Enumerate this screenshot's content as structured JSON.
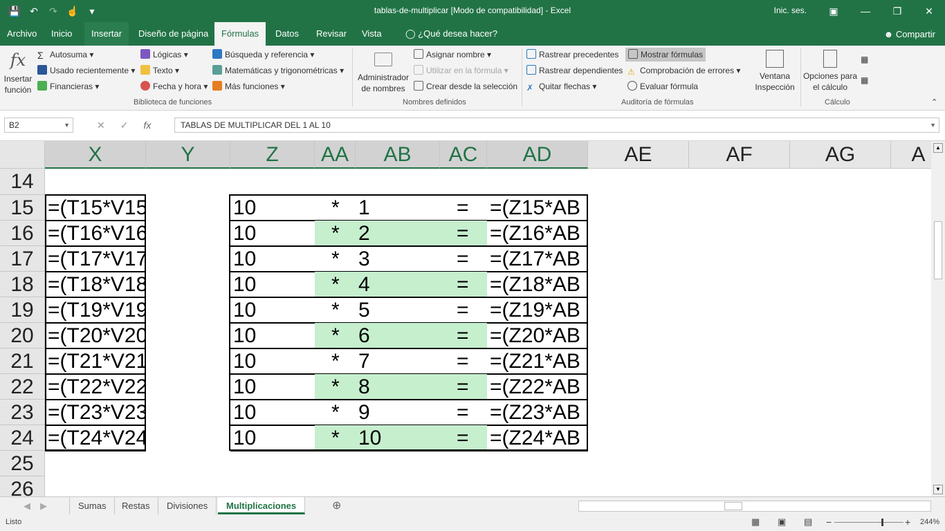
{
  "window": {
    "title": "tablas-de-multiplicar  [Modo de compatibilidad]  -  Excel",
    "signin": "Inic. ses.",
    "qat": [
      "save-icon",
      "undo-icon",
      "redo-icon",
      "touch-icon",
      "customize-icon"
    ]
  },
  "tabs": [
    "Archivo",
    "Inicio",
    "Insertar",
    "Diseño de página",
    "Fórmulas",
    "Datos",
    "Revisar",
    "Vista",
    "¿Qué desea hacer?"
  ],
  "share": "Compartir",
  "ribbon": {
    "insert_fn": "Insertar función",
    "lib": [
      "Autosuma",
      "Usado recientemente",
      "Financieras",
      "Lógicas",
      "Texto",
      "Fecha y hora",
      "Búsqueda y referencia",
      "Matemáticas y trigonométricas",
      "Más funciones"
    ],
    "lib_group": "Biblioteca de funciones",
    "names_admin": "Administrador de nombres",
    "names": [
      "Asignar nombre",
      "Utilizar en la fórmula",
      "Crear desde la selección"
    ],
    "names_group": "Nombres definidos",
    "audit": [
      "Rastrear precedentes",
      "Rastrear dependientes",
      "Quitar flechas",
      "Mostrar fórmulas",
      "Comprobación de errores",
      "Evaluar fórmula"
    ],
    "watch": "Ventana Inspección",
    "audit_group": "Auditoría de fórmulas",
    "calc_opts": "Opciones para el cálculo",
    "calc_group": "Cálculo"
  },
  "formula_bar": {
    "name_box": "B2",
    "formula": "TABLAS DE MULTIPLICAR DEL 1 AL 10"
  },
  "columns": [
    "X",
    "Y",
    "Z",
    "AA",
    "AB",
    "AC",
    "AD",
    "AE",
    "AF",
    "AG",
    "A"
  ],
  "rows": [
    "14",
    "15",
    "16",
    "17",
    "18",
    "19",
    "20",
    "21",
    "22",
    "23",
    "24",
    "25",
    "26"
  ],
  "table": [
    {
      "x": "=(T15*V15",
      "z": "10",
      "op": "*",
      "n": "1",
      "eq": "=",
      "f": "=(Z15*AB"
    },
    {
      "x": "=(T16*V16",
      "z": "10",
      "op": "*",
      "n": "2",
      "eq": "=",
      "f": "=(Z16*AB"
    },
    {
      "x": "=(T17*V17",
      "z": "10",
      "op": "*",
      "n": "3",
      "eq": "=",
      "f": "=(Z17*AB"
    },
    {
      "x": "=(T18*V18",
      "z": "10",
      "op": "*",
      "n": "4",
      "eq": "=",
      "f": "=(Z18*AB"
    },
    {
      "x": "=(T19*V19",
      "z": "10",
      "op": "*",
      "n": "5",
      "eq": "=",
      "f": "=(Z19*AB"
    },
    {
      "x": "=(T20*V20",
      "z": "10",
      "op": "*",
      "n": "6",
      "eq": "=",
      "f": "=(Z20*AB"
    },
    {
      "x": "=(T21*V21",
      "z": "10",
      "op": "*",
      "n": "7",
      "eq": "=",
      "f": "=(Z21*AB"
    },
    {
      "x": "=(T22*V22",
      "z": "10",
      "op": "*",
      "n": "8",
      "eq": "=",
      "f": "=(Z22*AB"
    },
    {
      "x": "=(T23*V23",
      "z": "10",
      "op": "*",
      "n": "9",
      "eq": "=",
      "f": "=(Z23*AB"
    },
    {
      "x": "=(T24*V24",
      "z": "10",
      "op": "*",
      "n": "10",
      "eq": "=",
      "f": "=(Z24*AB"
    }
  ],
  "sheets": [
    "Sumas",
    "Restas",
    "Divisiones",
    "Multiplicaciones"
  ],
  "status": {
    "ready": "Listo",
    "zoom": "244%"
  },
  "colors": {
    "excel_green": "#217346",
    "band_green": "#c6efce"
  }
}
